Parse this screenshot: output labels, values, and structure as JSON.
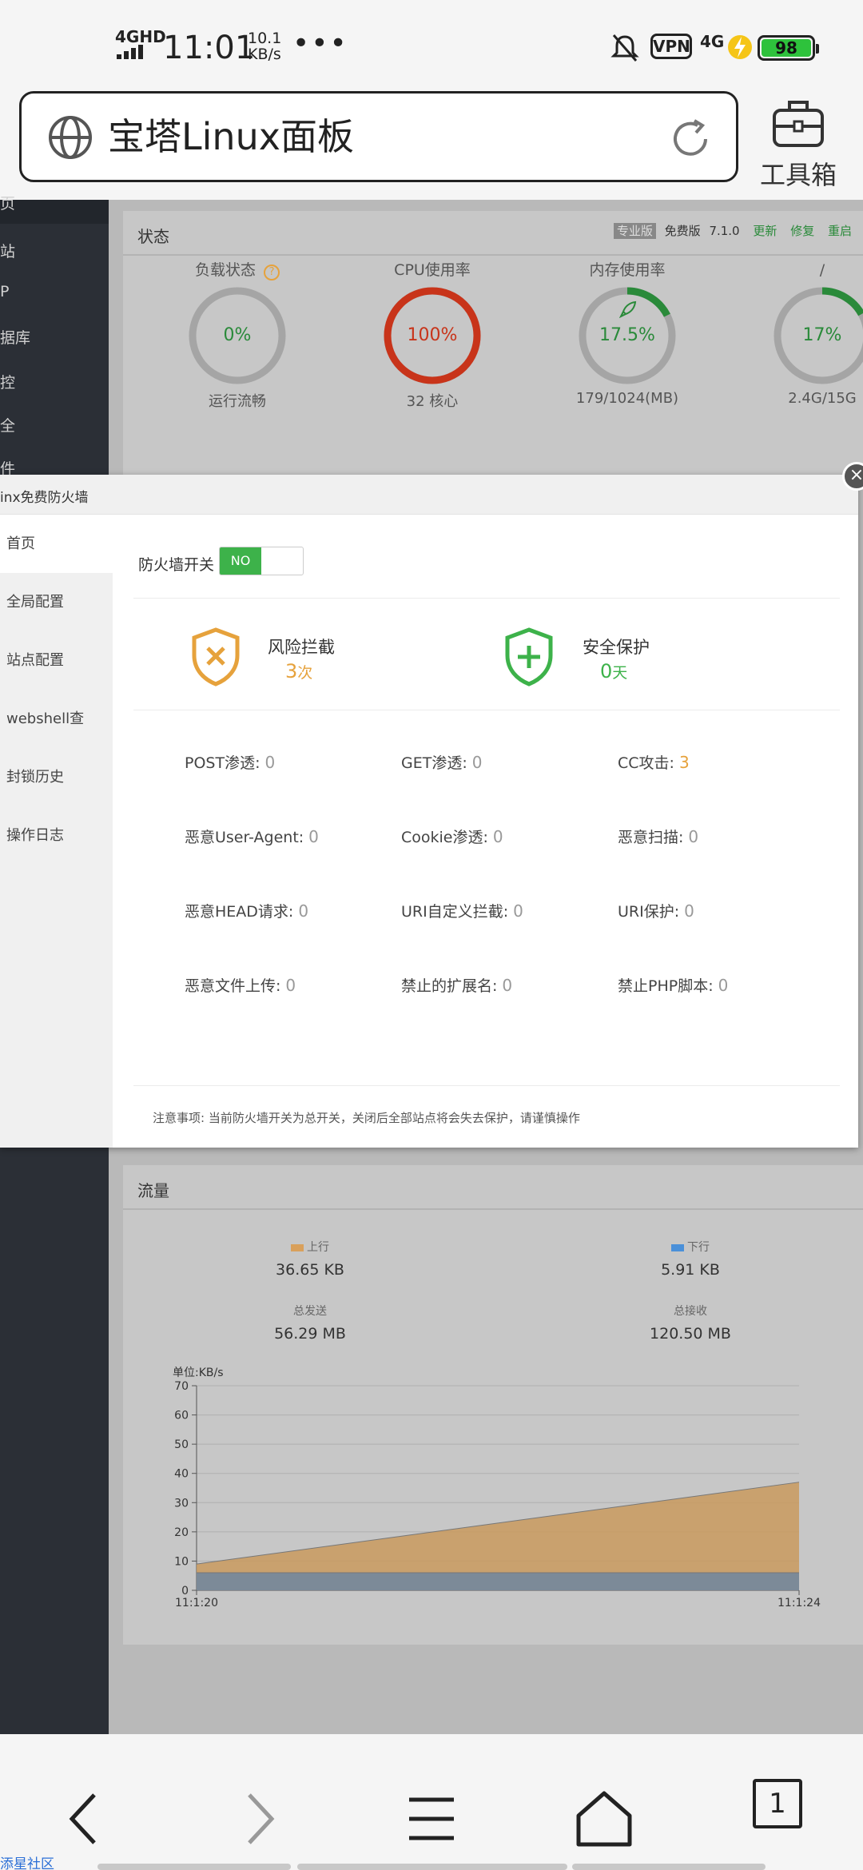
{
  "status_bar": {
    "network": "4GHD",
    "time": "11:01",
    "speed_value": "10.1",
    "speed_unit": "KB/s",
    "more": "•••",
    "vpn": "VPN",
    "network2": "4G",
    "battery": "98"
  },
  "browser": {
    "title": "宝塔Linux面板",
    "toolbox_label": "工具箱",
    "tab_count": "1",
    "bottom_link": "添星社区"
  },
  "sidenav": {
    "items": [
      "页",
      "站",
      "P",
      "据库",
      "控",
      "全",
      "件"
    ]
  },
  "status_card": {
    "title": "状态",
    "pro_badge": "专业版",
    "free_label": "免费版",
    "version": "7.1.0",
    "links": [
      "更新",
      "修复",
      "重启"
    ],
    "gauges": [
      {
        "label": "负载状态",
        "value": "0%",
        "sub": "运行流畅",
        "percent": 0,
        "color": "#2a8a3a"
      },
      {
        "label": "CPU使用率",
        "value": "100%",
        "sub": "32 核心",
        "percent": 100,
        "color": "#c8341a"
      },
      {
        "label": "内存使用率",
        "value": "17.5%",
        "sub": "179/1024(MB)",
        "percent": 17.5,
        "color": "#2a8a3a"
      },
      {
        "label": "/",
        "value": "17%",
        "sub": "2.4G/15G",
        "percent": 17,
        "color": "#2a8a3a"
      }
    ],
    "help_icon": "?"
  },
  "modal": {
    "title": "inx免费防火墙",
    "close": "×",
    "menu": [
      "首页",
      "全局配置",
      "站点配置",
      "webshell查",
      "封锁历史",
      "操作日志"
    ],
    "switch_label": "防火墙开关",
    "switch_state": "NO",
    "risk": {
      "title": "风险拦截",
      "count": "3",
      "unit": "次",
      "color": "#e6a23c"
    },
    "safe": {
      "title": "安全保护",
      "count": "0",
      "unit": "天",
      "color": "#3db24a"
    },
    "stats": [
      {
        "label": "POST渗透:",
        "value": "0"
      },
      {
        "label": "GET渗透:",
        "value": "0"
      },
      {
        "label": "CC攻击:",
        "value": "3",
        "hot": true
      },
      {
        "label": "恶意User-Agent:",
        "value": "0"
      },
      {
        "label": "Cookie渗透:",
        "value": "0"
      },
      {
        "label": "恶意扫描:",
        "value": "0"
      },
      {
        "label": "恶意HEAD请求:",
        "value": "0"
      },
      {
        "label": "URI自定义拦截:",
        "value": "0"
      },
      {
        "label": "URI保护:",
        "value": "0"
      },
      {
        "label": "恶意文件上传:",
        "value": "0"
      },
      {
        "label": "禁止的扩展名:",
        "value": "0"
      },
      {
        "label": "禁止PHP脚本:",
        "value": "0"
      }
    ],
    "note": "注意事项: 当前防火墙开关为总开关，关闭后全部站点将会失去保护，请谨慎操作"
  },
  "traffic": {
    "title": "流量",
    "up_label": "上行",
    "up_value": "36.65 KB",
    "down_label": "下行",
    "down_value": "5.91 KB",
    "sent_label": "总发送",
    "sent_value": "56.29 MB",
    "recv_label": "总接收",
    "recv_value": "120.50 MB",
    "colors": {
      "up": "#d9a05b",
      "down": "#4a90d9"
    }
  },
  "chart_data": {
    "type": "area",
    "ylabel": "单位:KB/s",
    "x": [
      "11:1:20",
      "11:1:24"
    ],
    "ylim": [
      0,
      70
    ],
    "yticks": [
      0,
      10,
      20,
      30,
      40,
      50,
      60,
      70
    ],
    "series": [
      {
        "name": "上行",
        "values": [
          9,
          37
        ],
        "color": "#c99a5e"
      },
      {
        "name": "下行",
        "values": [
          6,
          6
        ],
        "color": "#6f86a0"
      }
    ],
    "grid": true
  }
}
